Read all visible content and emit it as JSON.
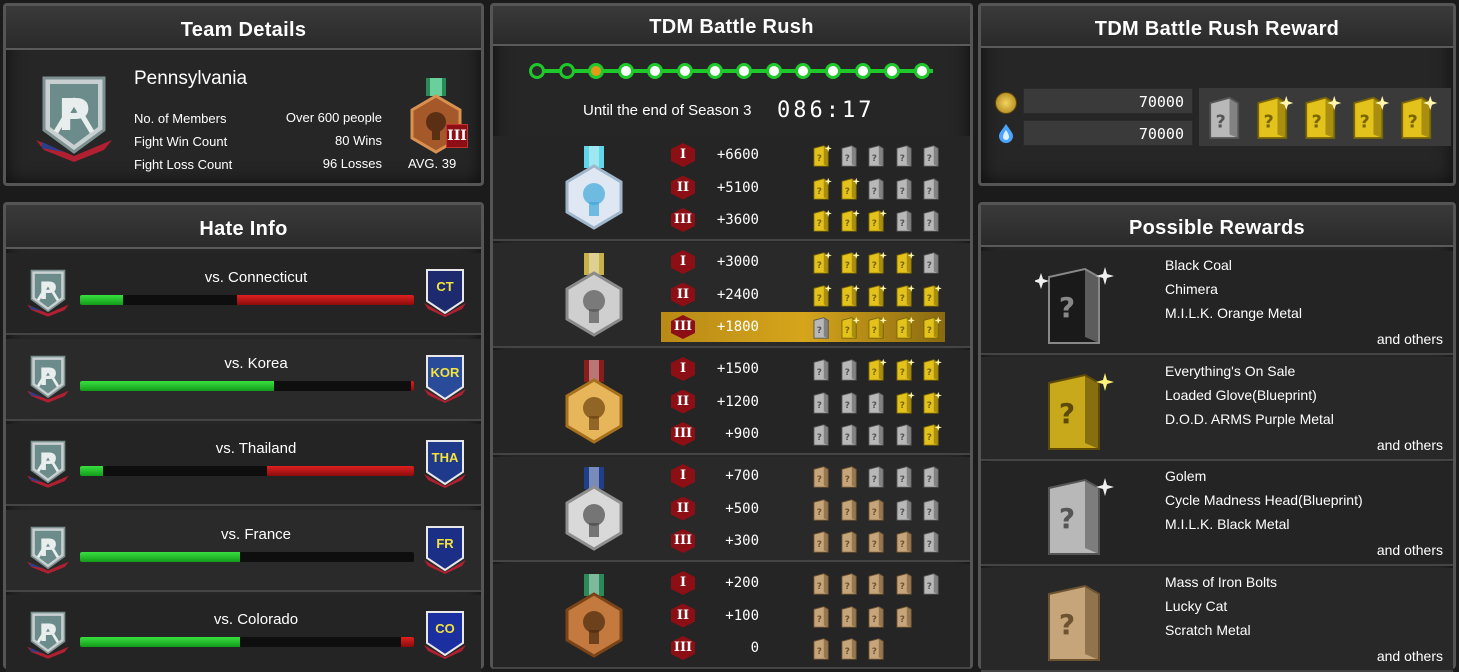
{
  "team_details": {
    "title": "Team Details",
    "team_name": "Pennsylvania",
    "rows": [
      {
        "label": "No. of Members",
        "value": "Over 600 people"
      },
      {
        "label": "Fight Win Count",
        "value": "80 Wins"
      },
      {
        "label": "Fight Loss Count",
        "value": "96 Losses"
      }
    ],
    "avg_label": "AVG. 39",
    "rank_numeral": "III"
  },
  "hate_info": {
    "title": "Hate Info",
    "rows": [
      {
        "vs": "vs. Connecticut",
        "opp_text": "CT",
        "opp_color": "#1d2a6e",
        "green": 0.13,
        "red": 0.53
      },
      {
        "vs": "vs. Korea",
        "opp_text": "KOR",
        "opp_color": "#2a4b9a",
        "green": 0.58,
        "red": 0.01
      },
      {
        "vs": "vs. Thailand",
        "opp_text": "THA",
        "opp_color": "#1f3a8a",
        "green": 0.07,
        "red": 0.44
      },
      {
        "vs": "vs. France",
        "opp_text": "FR",
        "opp_color": "#1c2f86",
        "green": 0.48,
        "red": 0.0
      },
      {
        "vs": "vs. Colorado",
        "opp_text": "CO",
        "opp_color": "#1b2fa0",
        "green": 0.48,
        "red": 0.04
      }
    ]
  },
  "battle_rush": {
    "title": "TDM Battle Rush",
    "progress": {
      "total_nodes": 14,
      "current_index": 2
    },
    "season_label": "Until the end of Season 3",
    "timer": "086:17",
    "groups": [
      {
        "medal": "diamond",
        "tiers": [
          {
            "numeral": "I",
            "points": "+6600",
            "boxes": [
              "gold",
              "silver",
              "silver",
              "silver",
              "silver"
            ]
          },
          {
            "numeral": "II",
            "points": "+5100",
            "boxes": [
              "gold",
              "gold",
              "silver",
              "silver",
              "silver"
            ]
          },
          {
            "numeral": "III",
            "points": "+3600",
            "boxes": [
              "gold",
              "gold",
              "gold",
              "silver",
              "silver"
            ]
          }
        ]
      },
      {
        "medal": "platinum",
        "tiers": [
          {
            "numeral": "I",
            "points": "+3000",
            "boxes": [
              "gold",
              "gold",
              "gold",
              "gold",
              "silver"
            ]
          },
          {
            "numeral": "II",
            "points": "+2400",
            "boxes": [
              "gold",
              "gold",
              "gold",
              "gold",
              "gold"
            ]
          },
          {
            "numeral": "III",
            "points": "+1800",
            "boxes": [
              "silver",
              "gold",
              "gold",
              "gold",
              "gold"
            ],
            "highlight": true
          }
        ]
      },
      {
        "medal": "gold",
        "tiers": [
          {
            "numeral": "I",
            "points": "+1500",
            "boxes": [
              "silver",
              "silver",
              "gold",
              "gold",
              "gold"
            ]
          },
          {
            "numeral": "II",
            "points": "+1200",
            "boxes": [
              "silver",
              "silver",
              "silver",
              "gold",
              "gold"
            ]
          },
          {
            "numeral": "III",
            "points": "+900",
            "boxes": [
              "silver",
              "silver",
              "silver",
              "silver",
              "gold"
            ]
          }
        ]
      },
      {
        "medal": "silver",
        "tiers": [
          {
            "numeral": "I",
            "points": "+700",
            "boxes": [
              "bronze",
              "bronze",
              "silver",
              "silver",
              "silver"
            ]
          },
          {
            "numeral": "II",
            "points": "+500",
            "boxes": [
              "bronze",
              "bronze",
              "bronze",
              "silver",
              "silver"
            ]
          },
          {
            "numeral": "III",
            "points": "+300",
            "boxes": [
              "bronze",
              "bronze",
              "bronze",
              "bronze",
              "silver"
            ]
          }
        ]
      },
      {
        "medal": "bronze",
        "tiers": [
          {
            "numeral": "I",
            "points": "+200",
            "boxes": [
              "bronze",
              "bronze",
              "bronze",
              "bronze",
              "silver"
            ]
          },
          {
            "numeral": "II",
            "points": "+100",
            "boxes": [
              "bronze",
              "bronze",
              "bronze",
              "bronze"
            ]
          },
          {
            "numeral": "III",
            "points": "0",
            "boxes": [
              "bronze",
              "bronze",
              "bronze"
            ]
          }
        ]
      }
    ]
  },
  "rush_reward": {
    "title": "TDM Battle Rush Reward",
    "coin_value": "70000",
    "gem_value": "70000",
    "boxes": [
      "silver",
      "gold",
      "gold",
      "gold",
      "gold"
    ]
  },
  "possible_rewards": {
    "title": "Possible Rewards",
    "and_others": "and others",
    "groups": [
      {
        "tier": "black",
        "items": [
          "Black Coal",
          "Chimera",
          "M.I.L.K. Orange Metal"
        ]
      },
      {
        "tier": "gold",
        "items": [
          "Everything's On Sale",
          "Loaded Glove(Blueprint)",
          "D.O.D. ARMS Purple Metal"
        ]
      },
      {
        "tier": "silver",
        "items": [
          "Golem",
          "Cycle Madness Head(Blueprint)",
          "M.I.L.K. Black Metal"
        ]
      },
      {
        "tier": "bronze",
        "items": [
          "Mass of Iron Bolts",
          "Lucky Cat",
          "Scratch Metal"
        ]
      }
    ]
  },
  "colors": {
    "green": "#1ec92a",
    "red": "#c41a1a",
    "gold_box": "#e3c21c",
    "silver_box": "#b8b8b8",
    "bronze_box": "#c6a57a",
    "tier_badge": "#8b0f15"
  }
}
